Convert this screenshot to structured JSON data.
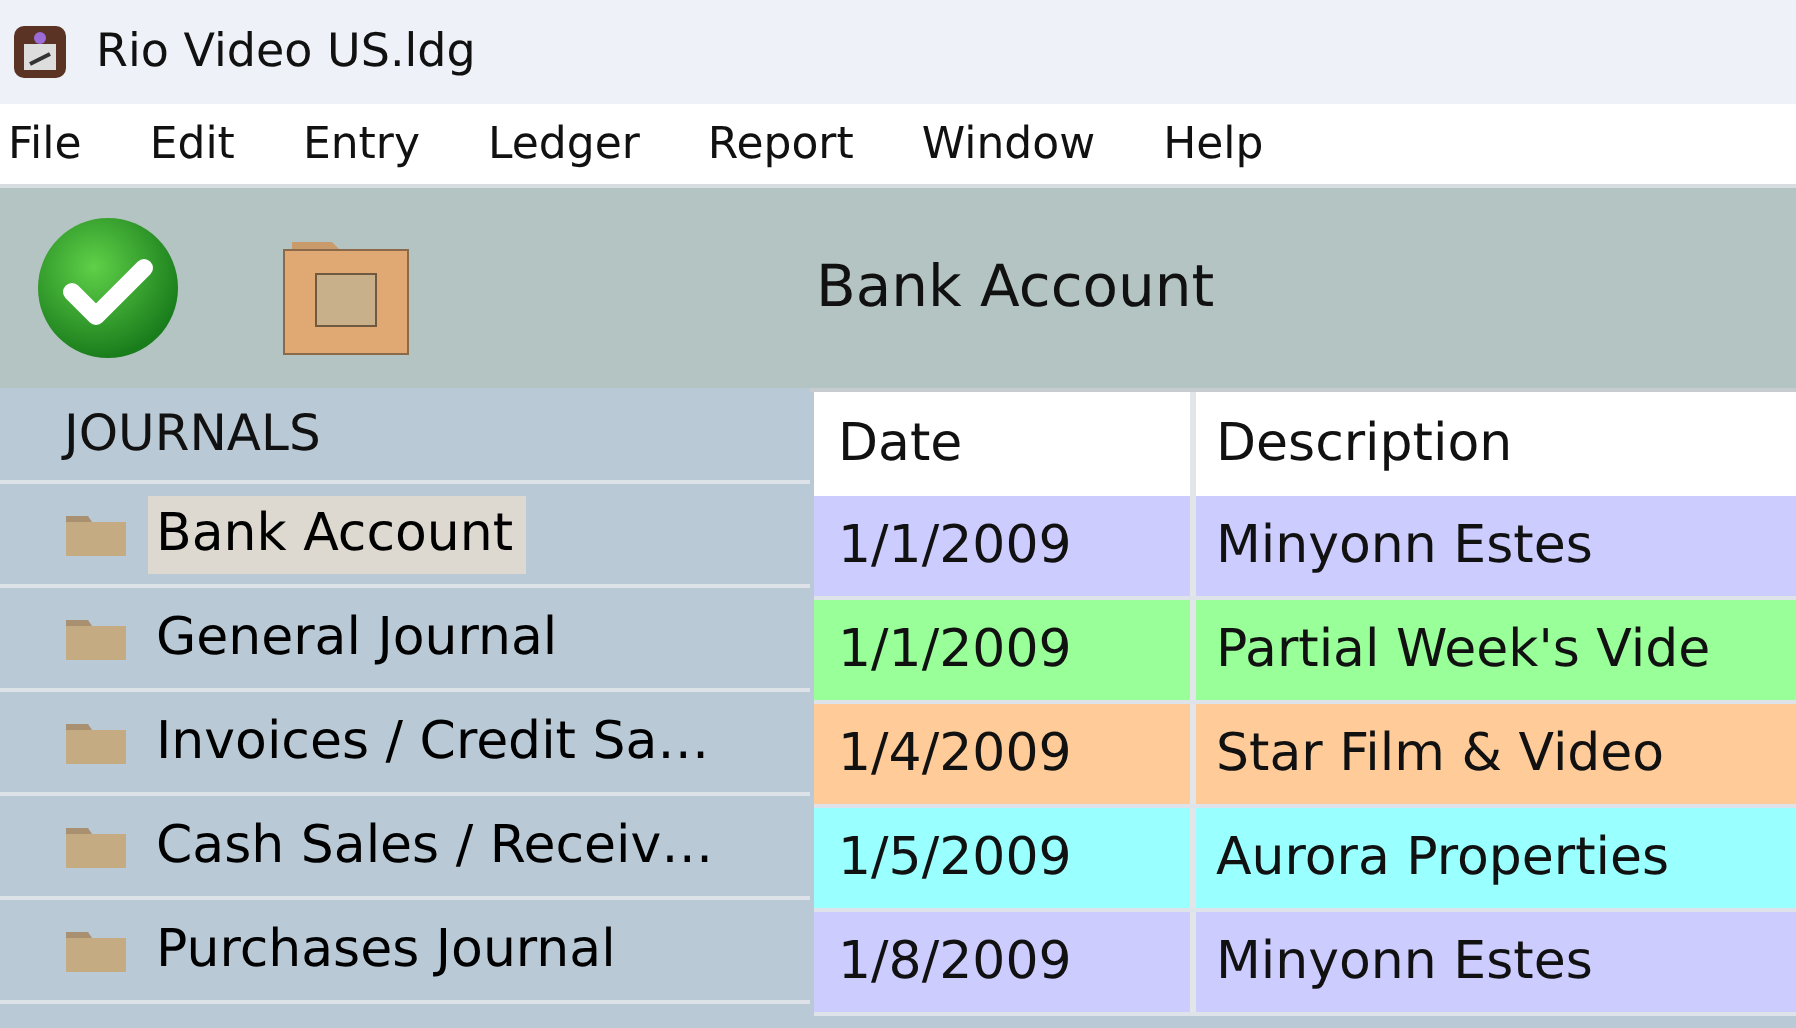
{
  "window": {
    "title": "Rio Video US.ldg"
  },
  "menu": [
    "File",
    "Edit",
    "Entry",
    "Ledger",
    "Report",
    "Window",
    "Help"
  ],
  "toolbar": {
    "title": "Bank Account"
  },
  "sidebar": {
    "heading": "JOURNALS",
    "items": [
      {
        "label": "Bank Account",
        "selected": true
      },
      {
        "label": "General Journal",
        "selected": false
      },
      {
        "label": "Invoices / Credit Sa…",
        "selected": false
      },
      {
        "label": "Cash Sales / Receiv…",
        "selected": false
      },
      {
        "label": "Purchases Journal",
        "selected": false
      }
    ]
  },
  "table": {
    "columns": [
      "Date",
      "Description"
    ],
    "rows": [
      {
        "date": "1/1/2009",
        "description": "Minyonn Estes",
        "color": "#ccccff"
      },
      {
        "date": "1/1/2009",
        "description": "Partial Week's Vide",
        "color": "#99ff99"
      },
      {
        "date": "1/4/2009",
        "description": "Star Film & Video",
        "color": "#ffcc99"
      },
      {
        "date": "1/5/2009",
        "description": "Aurora Properties",
        "color": "#99ffff"
      },
      {
        "date": "1/8/2009",
        "description": "Minyonn Estes",
        "color": "#ccccff"
      }
    ]
  }
}
